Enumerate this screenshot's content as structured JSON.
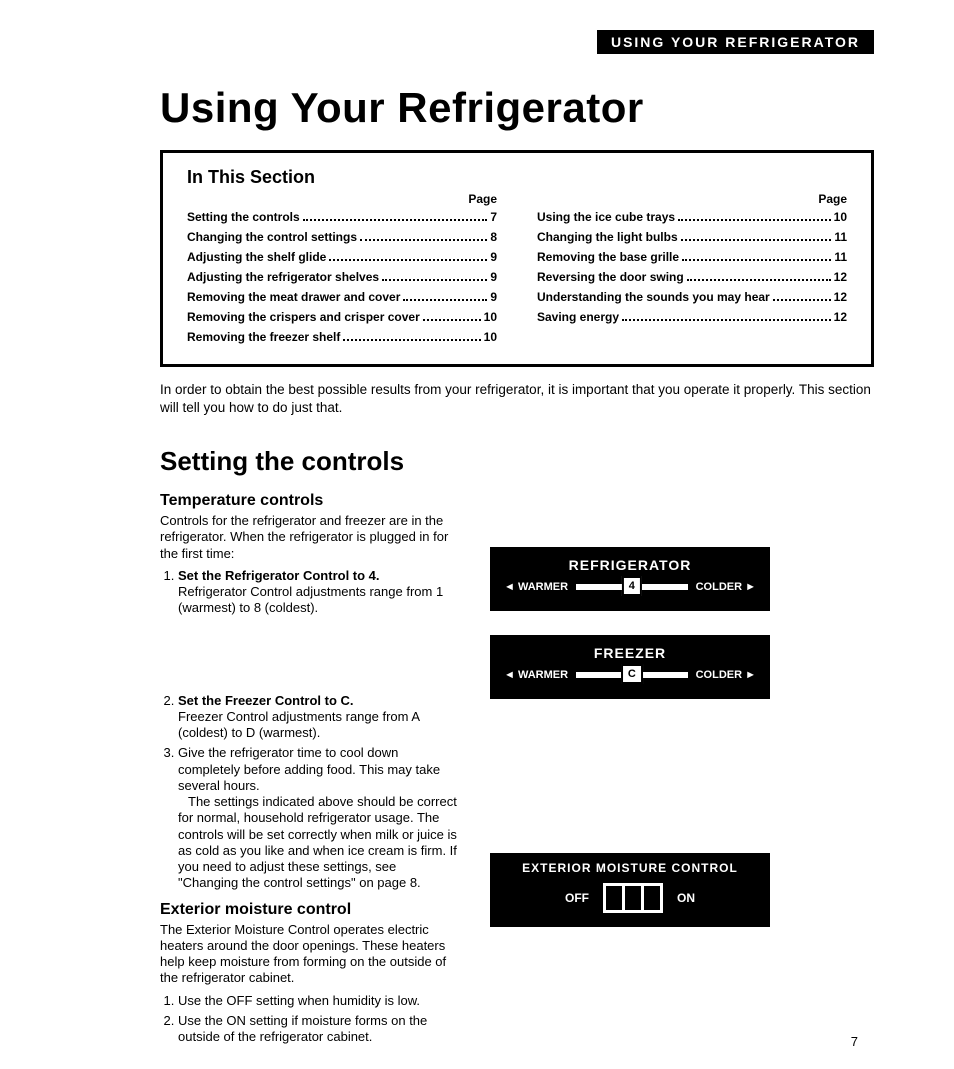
{
  "header_bar": "USING YOUR REFRIGERATOR",
  "main_title": "Using Your Refrigerator",
  "toc": {
    "title": "In This Section",
    "page_label": "Page",
    "left": [
      {
        "t": "Setting the controls",
        "p": "7"
      },
      {
        "t": "Changing the control settings",
        "p": "8"
      },
      {
        "t": "Adjusting the shelf glide",
        "p": "9"
      },
      {
        "t": "Adjusting the refrigerator shelves",
        "p": "9"
      },
      {
        "t": "Removing the meat drawer and cover",
        "p": "9"
      },
      {
        "t": "Removing the crispers and crisper cover",
        "p": "10"
      },
      {
        "t": "Removing the freezer shelf",
        "p": "10"
      }
    ],
    "right": [
      {
        "t": "Using the ice cube trays",
        "p": "10"
      },
      {
        "t": "Changing the light bulbs",
        "p": "11"
      },
      {
        "t": "Removing the base grille",
        "p": "11"
      },
      {
        "t": "Reversing the door swing",
        "p": "12"
      },
      {
        "t": "Understanding the sounds you may hear",
        "p": "12"
      },
      {
        "t": "Saving energy",
        "p": "12"
      }
    ]
  },
  "intro": "In order to obtain the best possible results from your refrigerator, it is important that you operate it properly. This section will tell you how to do just that.",
  "section_title": "Setting the controls",
  "temp": {
    "title": "Temperature controls",
    "intro": "Controls for the refrigerator and freezer are in the refrigerator. When the refrigerator is plugged in for the first time:",
    "step1_bold": "Set the Refrigerator Control to 4.",
    "step1_body": "Refrigerator Control adjustments range from 1 (warmest) to 8 (coldest).",
    "step2_bold": "Set the Freezer Control to C.",
    "step2_body": "Freezer Control adjustments range from A (coldest) to D (warmest).",
    "step3_body": "Give the refrigerator time to cool down completely before adding food. This may take several hours.",
    "step3_note": "The settings indicated above should be correct for normal, household refrigerator usage. The controls will be set correctly when milk or juice is as cold as you like and when ice cream is firm. If you need to adjust these settings, see \"Changing the control settings\" on page 8."
  },
  "ext": {
    "title": "Exterior moisture control",
    "intro": "The Exterior Moisture Control operates electric heaters around the door openings. These heaters help keep moisture from forming on the outside of the refrigerator cabinet.",
    "step1": "Use the OFF setting when humidity is low.",
    "step2": "Use the ON setting if moisture forms on the outside of the refrigerator cabinet."
  },
  "fig": {
    "refrig": {
      "title": "REFRIGERATOR",
      "warmer": "◄ WARMER",
      "colder": "COLDER ►",
      "value": "4"
    },
    "freezer": {
      "title": "FREEZER",
      "warmer": "◄ WARMER",
      "colder": "COLDER ►",
      "value": "C"
    },
    "emc": {
      "title": "EXTERIOR MOISTURE CONTROL",
      "off": "OFF",
      "on": "ON"
    }
  },
  "page_number": "7"
}
